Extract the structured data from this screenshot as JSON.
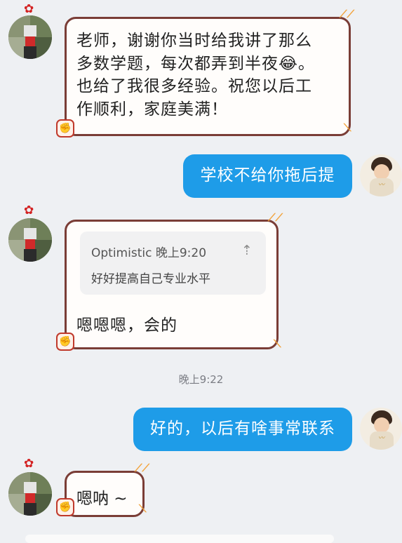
{
  "messages": [
    {
      "side": "left",
      "text": "老师，谢谢你当时给我讲了那么多数学题，每次都弄到半夜😂。也给了我很多经验。祝您以后工作顺利，家庭美满！"
    },
    {
      "side": "right",
      "text": "学校不给你拖后提"
    },
    {
      "side": "left",
      "quote": {
        "sender": "Optimistic",
        "time": "晚上9:20",
        "text": "好好提高自己专业水平"
      },
      "text": "嗯嗯嗯，会的"
    },
    {
      "side": "right",
      "text": "好的，以后有啥事常联系"
    },
    {
      "side": "left",
      "text": "嗯呐 ~"
    }
  ],
  "first_msg_lines": [
    "老师，谢谢你当时给我讲了那么",
    "多数学题，每次都弄到半夜😂。",
    "也给了我很多经验。祝您以后工",
    "作顺利，家庭美满！"
  ],
  "time_divider": "晚上9:22",
  "colors": {
    "bubble_right": "#1e9ce8",
    "bubble_left_border": "#7a3d36",
    "background": "#eef0f3",
    "accent_deco": "#f2a23a"
  }
}
